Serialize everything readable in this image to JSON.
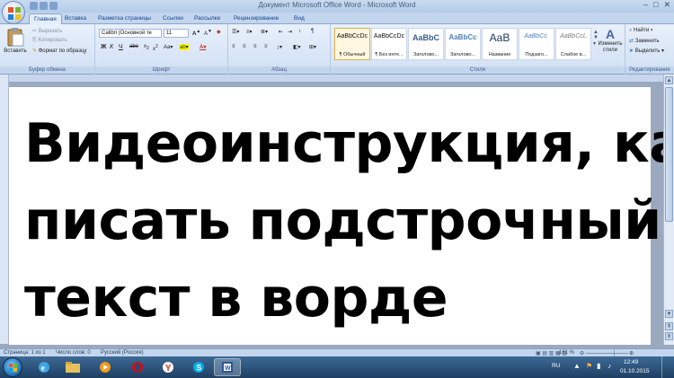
{
  "window": {
    "title": "Документ Microsoft Office Word - Microsoft Word"
  },
  "ribbon_tabs": [
    "Главная",
    "Вставка",
    "Разметка страницы",
    "Ссылки",
    "Рассылки",
    "Рецензирование",
    "Вид"
  ],
  "clipboard": {
    "paste_label": "Вставить",
    "cut_label": "Вырезать",
    "copy_label": "Копировать",
    "format_painter_label": "Формат по образцу",
    "group_label": "Буфер обмена"
  },
  "font": {
    "family_value": "Calibri (Основной те",
    "size_value": "11",
    "group_label": "Шрифт"
  },
  "paragraph": {
    "group_label": "Абзац"
  },
  "styles": {
    "items": [
      {
        "sample": "AaBbCcDc",
        "name": "¶ Обычный"
      },
      {
        "sample": "AaBbCcDc",
        "name": "¶ Без инте..."
      },
      {
        "sample": "AaBbC",
        "name": "Заголово..."
      },
      {
        "sample": "AaBbCc",
        "name": "Заголово..."
      },
      {
        "sample": "AaB",
        "name": "Название"
      },
      {
        "sample": "AaBbCc.",
        "name": "Подзаго..."
      },
      {
        "sample": "AaBbCcL",
        "name": "Слабое в..."
      }
    ],
    "change_styles_label": "Изменить стили",
    "group_label": "Стили"
  },
  "editing": {
    "find_label": "Найти",
    "replace_label": "Заменить",
    "select_label": "Выделить",
    "group_label": "Редактирование"
  },
  "document": {
    "lines": [
      "Видеоинструкция, как",
      "писать подстрочный",
      "текст в ворде"
    ]
  },
  "status_bar": {
    "page": "Страница: 1 из 1",
    "words": "Число слов: 0",
    "language": "Русский (Россия)",
    "zoom": "161 %"
  },
  "taskbar": {
    "lang": "RU",
    "time": "12:49",
    "date": "01.10.2015"
  },
  "colors": {
    "accent": "#15428b",
    "ribbon": "#d1e0f4",
    "taskbar": "#1f3f63"
  }
}
